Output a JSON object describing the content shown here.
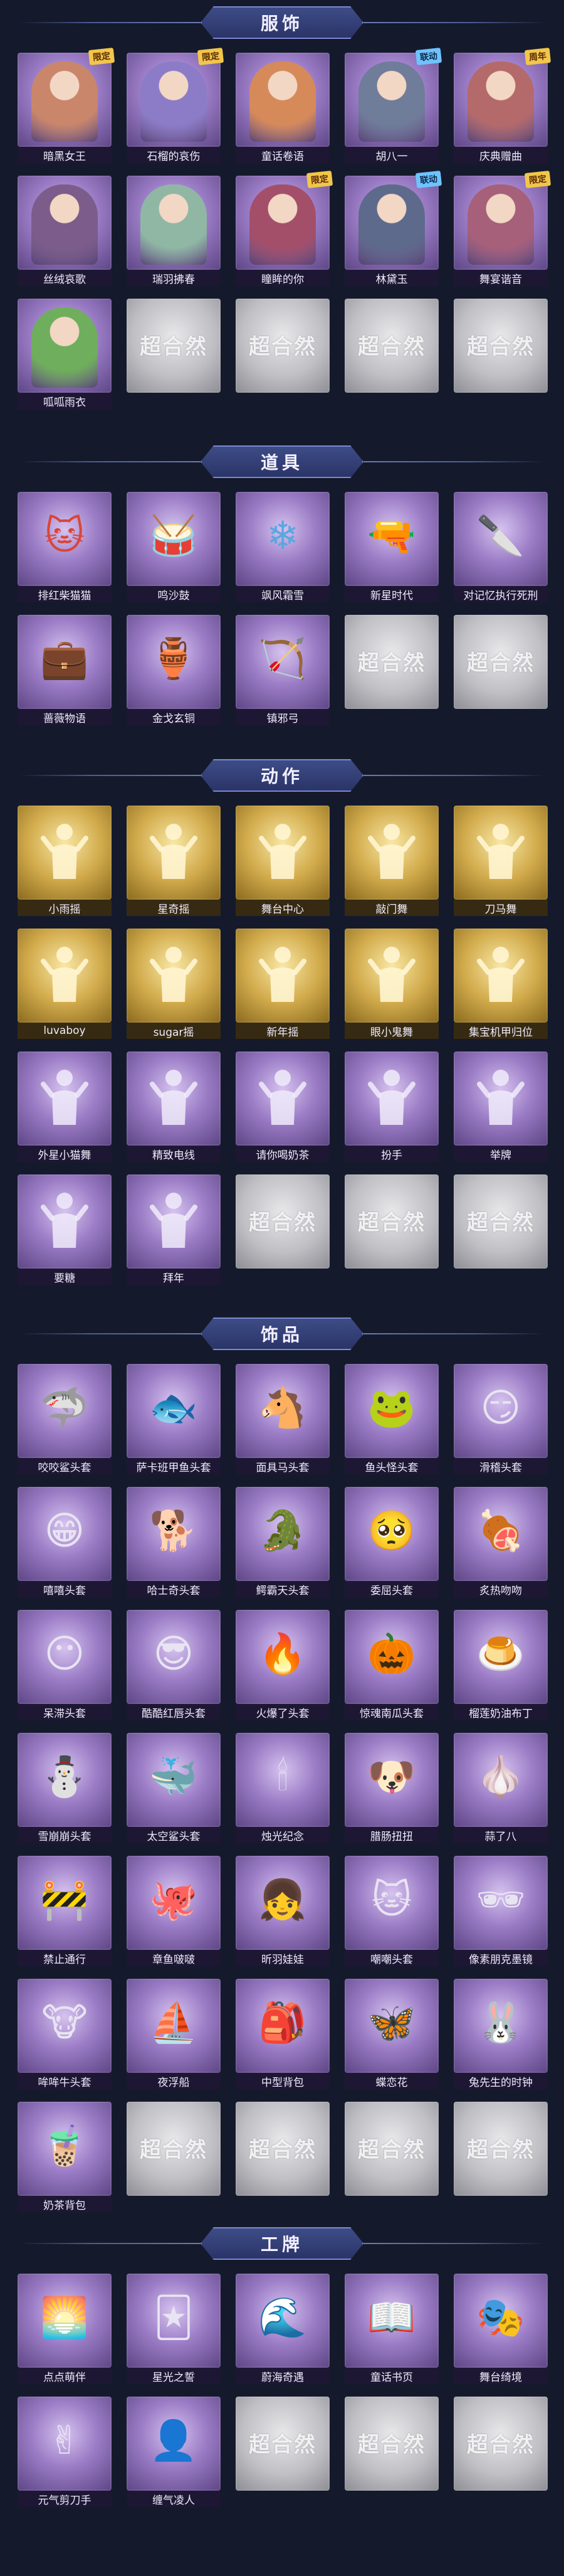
{
  "sections": [
    {
      "title": "服饰",
      "cards": [
        {
          "label": "暗黑女王",
          "style": "purple",
          "badge": "限定",
          "color": "#c9866a"
        },
        {
          "label": "石榴的哀伤",
          "style": "purple",
          "badge": "限定",
          "color": "#8c7cc8"
        },
        {
          "label": "童话卷语",
          "style": "purple",
          "badge": "",
          "color": "#d68a5a"
        },
        {
          "label": "胡八一",
          "style": "purple",
          "badge": "联动",
          "color": "#6f7c9a"
        },
        {
          "label": "庆典赠曲",
          "style": "purple",
          "badge": "周年",
          "color": "#b46a6a"
        },
        {
          "label": "丝绒哀歌",
          "style": "purple",
          "badge": "",
          "color": "#7c5c8a"
        },
        {
          "label": "瑞羽拂春",
          "style": "purple",
          "badge": "",
          "color": "#8fb7a4"
        },
        {
          "label": "瞳眸的你",
          "style": "purple",
          "badge": "限定",
          "color": "#a34f6a"
        },
        {
          "label": "林黛玉",
          "style": "purple",
          "badge": "联动",
          "color": "#5d6a8c"
        },
        {
          "label": "舞宴谐音",
          "style": "purple",
          "badge": "限定",
          "color": "#a6607a"
        },
        {
          "label": "呱呱雨衣",
          "style": "purple",
          "badge": "",
          "color": "#6fae5c"
        },
        {
          "label": "",
          "style": "empty",
          "badge": "",
          "color": ""
        },
        {
          "label": "",
          "style": "empty",
          "badge": "",
          "color": ""
        },
        {
          "label": "",
          "style": "empty",
          "badge": "",
          "color": ""
        },
        {
          "label": "",
          "style": "empty",
          "badge": "",
          "color": ""
        }
      ]
    },
    {
      "title": "道具",
      "cards": [
        {
          "label": "排红柴猫猫",
          "style": "purple",
          "icon": "🐱",
          "color": "#d9463a"
        },
        {
          "label": "鸣沙鼓",
          "style": "purple",
          "icon": "🥁",
          "color": "#c88a56"
        },
        {
          "label": "飒风霜雪",
          "style": "purple",
          "icon": "❄",
          "color": "#5aa7e0"
        },
        {
          "label": "新星时代",
          "style": "purple",
          "icon": "🔫",
          "color": "#c7883a"
        },
        {
          "label": "对记忆执行死刑",
          "style": "purple",
          "icon": "🔪",
          "color": "#8a4fb0"
        },
        {
          "label": "蔷薇物语",
          "style": "purple",
          "icon": "💼",
          "color": "#b22a3e"
        },
        {
          "label": "金戈玄铜",
          "style": "purple",
          "icon": "🏺",
          "color": "#6e8a5a"
        },
        {
          "label": "镇邪弓",
          "style": "purple",
          "icon": "🏹",
          "color": "#7a3030"
        },
        {
          "label": "",
          "style": "empty",
          "icon": "",
          "color": ""
        },
        {
          "label": "",
          "style": "empty",
          "icon": "",
          "color": ""
        }
      ]
    },
    {
      "title": "动作",
      "cards": [
        {
          "label": "小雨摇",
          "style": "gold"
        },
        {
          "label": "星奇摇",
          "style": "gold"
        },
        {
          "label": "舞台中心",
          "style": "gold"
        },
        {
          "label": "敲门舞",
          "style": "gold"
        },
        {
          "label": "刀马舞",
          "style": "gold"
        },
        {
          "label": "luvaboy",
          "style": "gold"
        },
        {
          "label": "sugar摇",
          "style": "gold"
        },
        {
          "label": "新年摇",
          "style": "gold"
        },
        {
          "label": "眼小鬼舞",
          "style": "gold"
        },
        {
          "label": "集宝机甲归位",
          "style": "gold"
        },
        {
          "label": "外星小猫舞",
          "style": "purple"
        },
        {
          "label": "精致电线",
          "style": "purple"
        },
        {
          "label": "请你喝奶茶",
          "style": "purple"
        },
        {
          "label": "扮手",
          "style": "purple"
        },
        {
          "label": "举牌",
          "style": "purple"
        },
        {
          "label": "要糖",
          "style": "purple"
        },
        {
          "label": "拜年",
          "style": "purple"
        },
        {
          "label": "",
          "style": "empty"
        },
        {
          "label": "",
          "style": "empty"
        },
        {
          "label": "",
          "style": "empty"
        }
      ]
    },
    {
      "title": "饰品",
      "cards": [
        {
          "label": "咬咬鲨头套",
          "style": "purple",
          "icon": "🦈"
        },
        {
          "label": "萨卡班甲鱼头套",
          "style": "purple",
          "icon": "🐟"
        },
        {
          "label": "面具马头套",
          "style": "purple",
          "icon": "🐴"
        },
        {
          "label": "鱼头怪头套",
          "style": "purple",
          "icon": "🐸"
        },
        {
          "label": "滑稽头套",
          "style": "purple",
          "icon": "😏"
        },
        {
          "label": "嘻嘻头套",
          "style": "purple",
          "icon": "😁"
        },
        {
          "label": "哈士奇头套",
          "style": "purple",
          "icon": "🐕"
        },
        {
          "label": "鳄霸天头套",
          "style": "purple",
          "icon": "🐊"
        },
        {
          "label": "委屈头套",
          "style": "purple",
          "icon": "🥺"
        },
        {
          "label": "炙热吻吻",
          "style": "purple",
          "icon": "🍖"
        },
        {
          "label": "呆滞头套",
          "style": "purple",
          "icon": "😶"
        },
        {
          "label": "酷酷红唇头套",
          "style": "purple",
          "icon": "😎"
        },
        {
          "label": "火爆了头套",
          "style": "purple",
          "icon": "🔥"
        },
        {
          "label": "惊魂南瓜头套",
          "style": "purple",
          "icon": "🎃"
        },
        {
          "label": "榴莲奶油布丁",
          "style": "purple",
          "icon": "🍮"
        },
        {
          "label": "雪崩崩头套",
          "style": "purple",
          "icon": "⛄"
        },
        {
          "label": "太空鲨头套",
          "style": "purple",
          "icon": "🐳"
        },
        {
          "label": "烛光纪念",
          "style": "purple",
          "icon": "🕯"
        },
        {
          "label": "腊肠扭扭",
          "style": "purple",
          "icon": "🐶"
        },
        {
          "label": "蒜了八",
          "style": "purple",
          "icon": "🧄"
        },
        {
          "label": "禁止通行",
          "style": "purple",
          "icon": "🚧"
        },
        {
          "label": "章鱼啵啵",
          "style": "purple",
          "icon": "🐙"
        },
        {
          "label": "昕羽娃娃",
          "style": "purple",
          "icon": "👧"
        },
        {
          "label": "嘲嘲头套",
          "style": "purple",
          "icon": "🐱"
        },
        {
          "label": "像素朋克墨镜",
          "style": "purple",
          "icon": "🕶"
        },
        {
          "label": "哞哞牛头套",
          "style": "purple",
          "icon": "🐮"
        },
        {
          "label": "夜浮船",
          "style": "purple",
          "icon": "⛵"
        },
        {
          "label": "中型背包",
          "style": "purple",
          "icon": "🎒"
        },
        {
          "label": "蝶恋花",
          "style": "purple",
          "icon": "🦋"
        },
        {
          "label": "兔先生的时钟",
          "style": "purple",
          "icon": "🐰"
        },
        {
          "label": "奶茶背包",
          "style": "purple",
          "icon": "🧋"
        },
        {
          "label": "",
          "style": "empty",
          "icon": ""
        },
        {
          "label": "",
          "style": "empty",
          "icon": ""
        },
        {
          "label": "",
          "style": "empty",
          "icon": ""
        },
        {
          "label": "",
          "style": "empty",
          "icon": ""
        }
      ]
    },
    {
      "title": "工牌",
      "cards": [
        {
          "label": "点点萌伴",
          "style": "purple",
          "icon": "🌅"
        },
        {
          "label": "星光之誓",
          "style": "purple",
          "icon": "🃏"
        },
        {
          "label": "蔚海奇遇",
          "style": "purple",
          "icon": "🌊"
        },
        {
          "label": "童话书页",
          "style": "purple",
          "icon": "📖"
        },
        {
          "label": "舞台绮境",
          "style": "purple",
          "icon": "🎭"
        },
        {
          "label": "元气剪刀手",
          "style": "purple",
          "icon": "✌"
        },
        {
          "label": "缠气凌人",
          "style": "purple",
          "icon": "👤"
        },
        {
          "label": "",
          "style": "empty",
          "icon": ""
        },
        {
          "label": "",
          "style": "empty",
          "icon": ""
        },
        {
          "label": "",
          "style": "empty",
          "icon": ""
        }
      ]
    }
  ],
  "empty_mark": "超合然"
}
